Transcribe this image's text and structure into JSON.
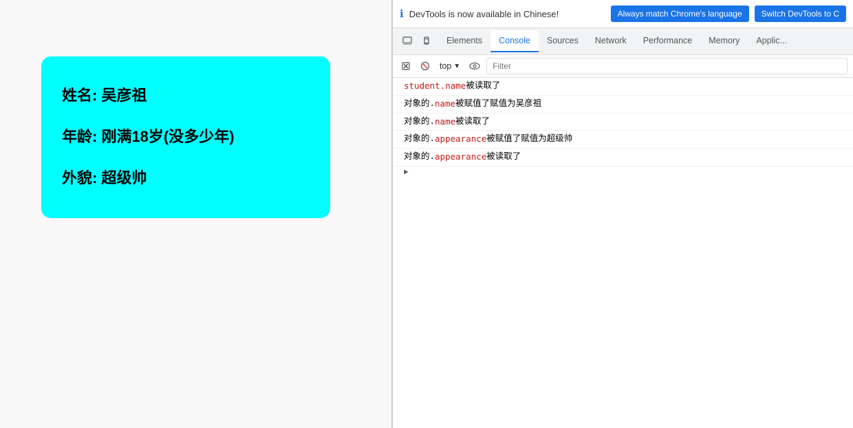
{
  "page": {
    "background": "#f8f8f8"
  },
  "student_card": {
    "name_label": "姓名: 吴彦祖",
    "age_label": "年龄: 刚满18岁(没多少年)",
    "appearance_label": "外貌: 超级帅"
  },
  "devtools": {
    "banner": {
      "text": "DevTools is now available in Chinese!",
      "btn1_label": "Always match Chrome's language",
      "btn2_label": "Switch DevTools to C"
    },
    "tabs": [
      {
        "id": "elements",
        "label": "Elements",
        "active": false
      },
      {
        "id": "console",
        "label": "Console",
        "active": true
      },
      {
        "id": "sources",
        "label": "Sources",
        "active": false
      },
      {
        "id": "network",
        "label": "Network",
        "active": false
      },
      {
        "id": "performance",
        "label": "Performance",
        "active": false
      },
      {
        "id": "memory",
        "label": "Memory",
        "active": false
      },
      {
        "id": "application",
        "label": "Applic...",
        "active": false
      }
    ],
    "console_toolbar": {
      "top_label": "top",
      "filter_placeholder": "Filter"
    },
    "console_lines": [
      {
        "id": "line1",
        "code": "student.name",
        "text": "被读取了"
      },
      {
        "id": "line2",
        "prefix": "对象的.",
        "code": "name",
        "middle": "被赋值了赋值为",
        "text": "吴彦祖"
      },
      {
        "id": "line3",
        "prefix": "对象的.",
        "code": "name",
        "text": "被读取了"
      },
      {
        "id": "line4",
        "prefix": "对象的.",
        "code": "appearance",
        "middle": "被赋值了赋值为",
        "text": "超级帅"
      },
      {
        "id": "line5",
        "prefix": "对象的.",
        "code": "appearance",
        "text": "被读取了"
      }
    ]
  }
}
